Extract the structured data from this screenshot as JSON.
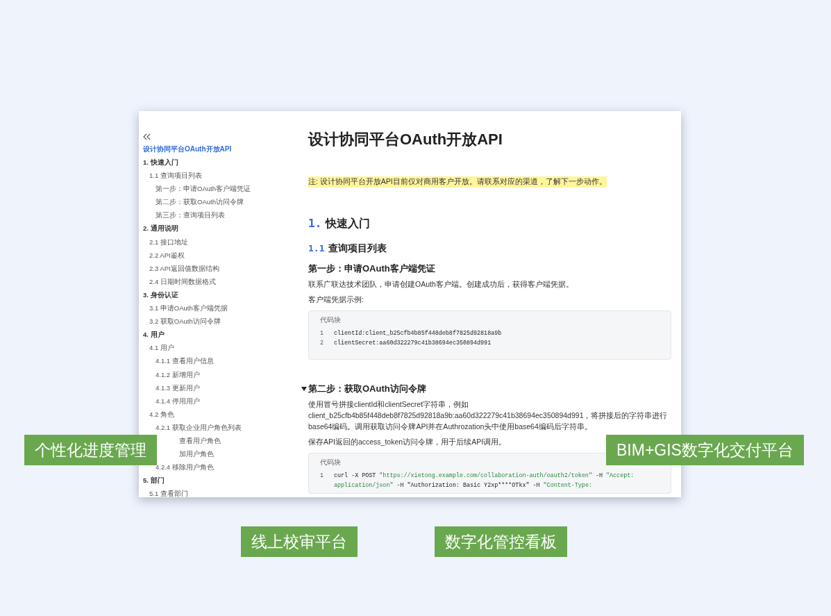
{
  "sidebar": {
    "title": "设计协同平台OAuth开放API",
    "toc": [
      {
        "label": "1. 快速入门",
        "children": [
          {
            "label": "1.1 查询项目列表",
            "children": [
              {
                "label": "第一步：申请OAuth客户端凭证"
              },
              {
                "label": "第二步：获取OAuth访问令牌"
              },
              {
                "label": "第三步：查询项目列表"
              }
            ]
          }
        ]
      },
      {
        "label": "2. 通用说明",
        "children": [
          {
            "label": "2.1 接口地址"
          },
          {
            "label": "2.2 API鉴权"
          },
          {
            "label": "2.3 API返回值数据结构"
          },
          {
            "label": "2.4 日期时间数据格式"
          }
        ]
      },
      {
        "label": "3. 身份认证",
        "children": [
          {
            "label": "3.1 申请OAuth客户端凭据"
          },
          {
            "label": "3.2 获取OAuth访问令牌"
          }
        ]
      },
      {
        "label": "4. 用户",
        "children": [
          {
            "label": "4.1 用户",
            "children": [
              {
                "label": "4.1.1 查看用户信息"
              },
              {
                "label": "4.1.2 新增用户"
              },
              {
                "label": "4.1.3 更新用户"
              },
              {
                "label": "4.1.4 停用用户"
              }
            ]
          },
          {
            "label": "4.2 角色",
            "children": [
              {
                "label": "4.2.1 获取企业用户角色列表"
              },
              {
                "label": "查看用户角色",
                "kind": "covered"
              },
              {
                "label": "加用户角色",
                "kind": "covered"
              },
              {
                "label": "4.2.4 移除用户角色"
              }
            ]
          }
        ]
      },
      {
        "label": "5. 部门",
        "children": [
          {
            "label": "5.1 查看部门"
          }
        ]
      }
    ]
  },
  "content": {
    "title": "设计协同平台OAuth开放API",
    "note": "注: 设计协同平台开放API目前仅对商用客户开放。请联系对应的渠道，了解下一步动作。",
    "blocks": [
      {
        "kind": "h1",
        "number": "1.",
        "text": "快速入门"
      },
      {
        "kind": "h2",
        "number": "1.1",
        "text": "查询项目列表"
      },
      {
        "kind": "h3",
        "text": "第一步：申请OAuth客户端凭证",
        "expanded": false
      },
      {
        "kind": "p",
        "text": "联系广联达技术团队，申请创建OAuth客户端。创建成功后，获得客户端凭据。"
      },
      {
        "kind": "p",
        "text": "客户端凭据示例:"
      },
      {
        "kind": "code",
        "label": "代码块",
        "lines": [
          {
            "number": "1",
            "segments": [
              {
                "kind": "plain",
                "text": "clientId:client_b25cfb4b85f448deb8f7825d92818a9b"
              }
            ]
          },
          {
            "number": "2",
            "segments": [
              {
                "kind": "plain",
                "text": "clientSecret:aa60d322279c41b38694ec350894d991"
              }
            ]
          }
        ]
      },
      {
        "kind": "h3",
        "text": "第二步：获取OAuth访问令牌",
        "expanded": true
      },
      {
        "kind": "p",
        "text": "使用冒号拼接clientId和clientSecret字符串，例如 client_b25cfb4b85f448deb8f7825d92818a9b:aa60d322279c41b38694ec350894d991，将拼接后的字符串进行base64编码。调用获取访问令牌API并在Authrozation头中使用base64编码后字符串。"
      },
      {
        "kind": "p",
        "text": "保存API返回的access_token访问令牌，用于后续API调用。"
      },
      {
        "kind": "code",
        "label": "代码块",
        "lines": [
          {
            "number": "1",
            "segments": [
              {
                "kind": "plain",
                "text": "curl -X POST "
              },
              {
                "kind": "string",
                "text": "\"https://xietong.example.com/collaboration-auth/oauth2/token\""
              },
              {
                "kind": "plain",
                "text": " -H "
              },
              {
                "kind": "string",
                "text": "\"Accept: application/json\""
              },
              {
                "kind": "plain",
                "text": " -H \"Authorization: Basic Y2xp****OTkx\" -H "
              },
              {
                "kind": "string",
                "text": "\"Content-Type:"
              }
            ]
          }
        ]
      }
    ]
  },
  "labels": [
    {
      "text": "个性化进度管理"
    },
    {
      "text": "BIM+GIS数字化交付平台"
    },
    {
      "text": "线上校审平台"
    },
    {
      "text": "数字化管控看板"
    }
  ]
}
